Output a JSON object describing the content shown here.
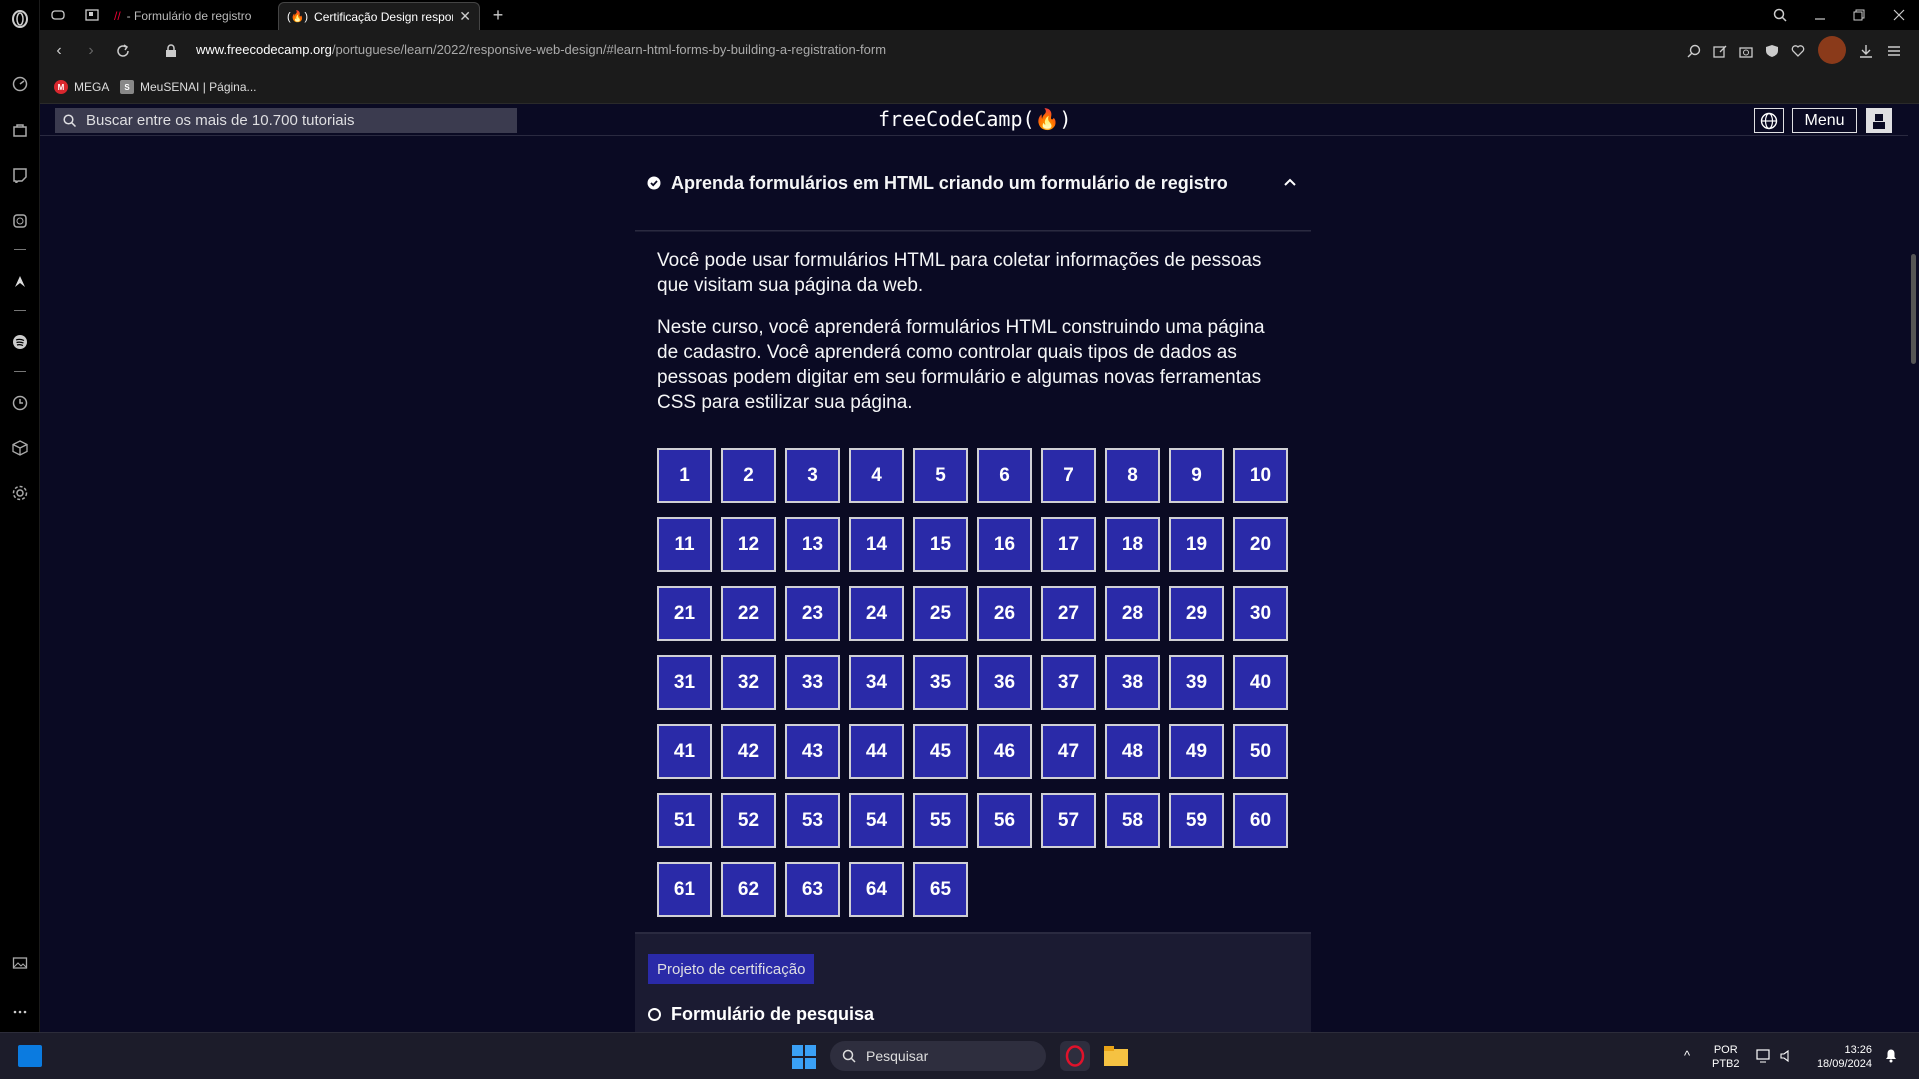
{
  "browser": {
    "tabs": [
      {
        "title": "- Formulário de registro"
      },
      {
        "title": "Certificação Design responsivo"
      }
    ],
    "new_tab": "+",
    "url_domain": "www.freecodecamp.org",
    "url_path": "/portuguese/learn/2022/responsive-web-design/#learn-html-forms-by-building-a-registration-form",
    "bookmarks": [
      {
        "label": "MEGA",
        "icon": "M",
        "color": "#d9272e"
      },
      {
        "label": "MeuSENAI | Página...",
        "icon": "S",
        "color": "#888888"
      }
    ]
  },
  "fcc_header": {
    "search_placeholder": "Buscar entre os mais de 10.700 tutoriais",
    "logo": "freeCodeCamp(🔥)",
    "menu_label": "Menu"
  },
  "block": {
    "title": "Aprenda formulários em HTML criando um formulário de registro",
    "paragraph1": "Você pode usar formulários HTML para coletar informações de pessoas que visitam sua página da web.",
    "paragraph2": "Neste curso, você aprenderá formulários HTML construindo uma página de cadastro. Você aprenderá como controlar quais tipos de dados as pessoas podem digitar em seu formulário e algumas novas ferramentas CSS para estilizar sua página.",
    "steps": [
      "1",
      "2",
      "3",
      "4",
      "5",
      "6",
      "7",
      "8",
      "9",
      "10",
      "11",
      "12",
      "13",
      "14",
      "15",
      "16",
      "17",
      "18",
      "19",
      "20",
      "21",
      "22",
      "23",
      "24",
      "25",
      "26",
      "27",
      "28",
      "29",
      "30",
      "31",
      "32",
      "33",
      "34",
      "35",
      "36",
      "37",
      "38",
      "39",
      "40",
      "41",
      "42",
      "43",
      "44",
      "45",
      "46",
      "47",
      "48",
      "49",
      "50",
      "51",
      "52",
      "53",
      "54",
      "55",
      "56",
      "57",
      "58",
      "59",
      "60",
      "61",
      "62",
      "63",
      "64",
      "65"
    ]
  },
  "certification": {
    "label": "Projeto de certificação",
    "project_title": "Formulário de pesquisa"
  },
  "taskbar": {
    "search_label": "Pesquisar",
    "lang_top": "POR",
    "lang_bottom": "PTB2",
    "time": "13:26",
    "date": "18/09/2024"
  },
  "colors": {
    "step_bg": "#2a2aa8",
    "page_bg": "#0a0a23",
    "accent_bar": "#1b1b32"
  }
}
